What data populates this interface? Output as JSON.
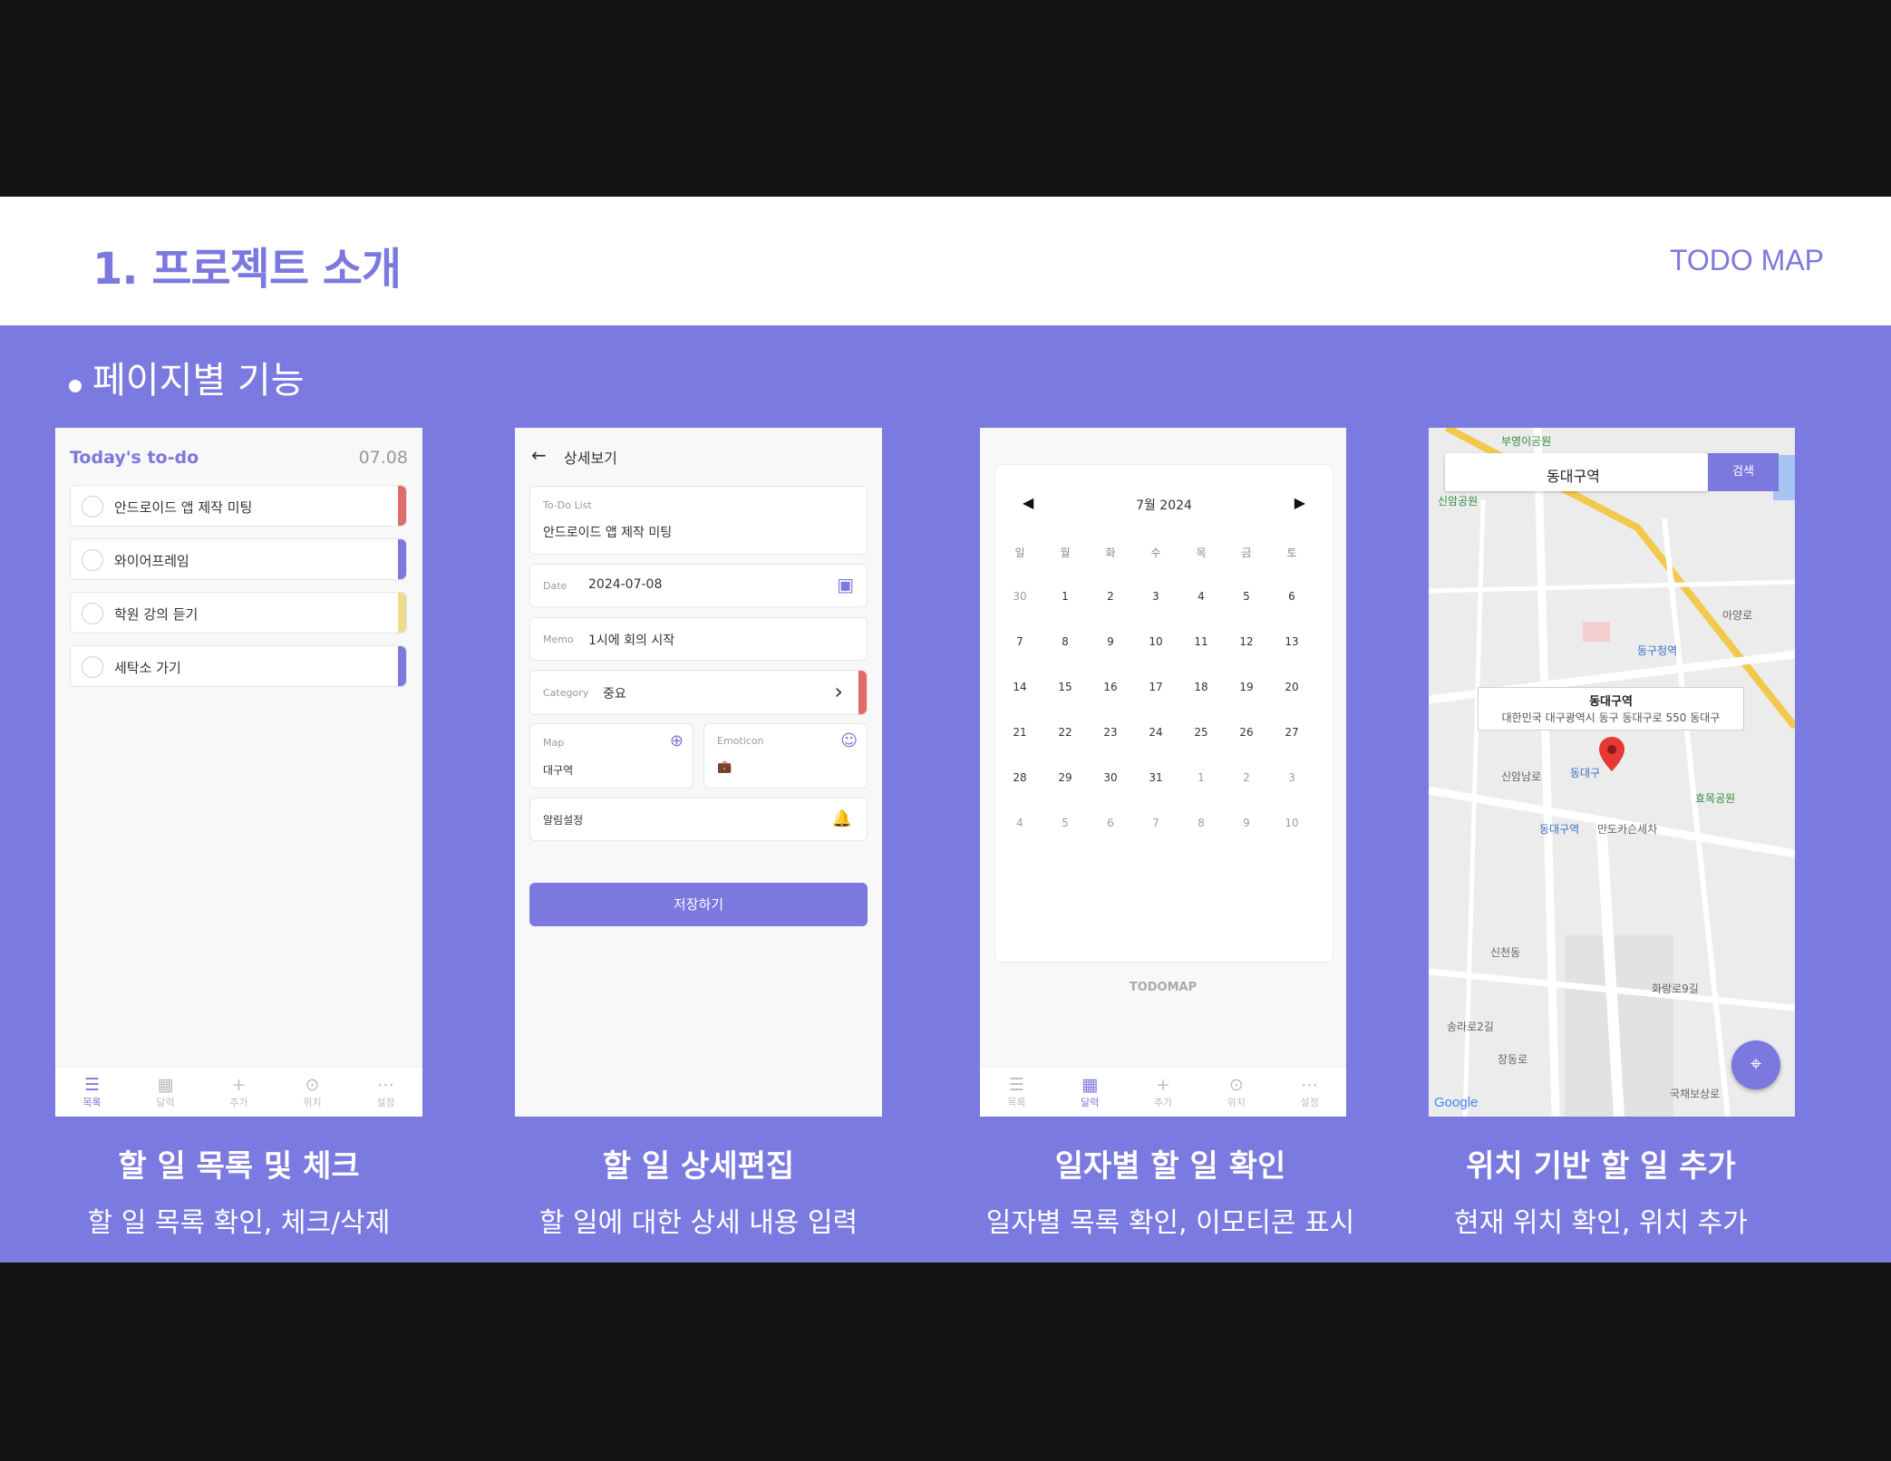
{
  "header": {
    "title": "1. 프로젝트 소개",
    "brand": "TODO MAP"
  },
  "section": {
    "title": "페이지별 기능"
  },
  "panels": [
    {
      "caption": "할 일 목록 및 체크",
      "desc": "할 일 목록 확인, 체크/삭제"
    },
    {
      "caption": "할 일 상세편집",
      "desc": "할 일에 대한 상세 내용 입력"
    },
    {
      "caption": "일자별 할 일 확인",
      "desc": "일자별 목록 확인, 이모티콘 표시"
    },
    {
      "caption": "위치 기반 할 일 추가",
      "desc": "현재 위치 확인, 위치 추가"
    }
  ],
  "todo_screen": {
    "title": "Today's to-do",
    "date": "07.08",
    "items": [
      {
        "label": "안드로이드 앱 제작 미팅",
        "color": "#e06b6b"
      },
      {
        "label": "와이어프레임",
        "color": "#7b78de"
      },
      {
        "label": "학원 강의 듣기",
        "color": "#efdb8e"
      },
      {
        "label": "세탁소 가기",
        "color": "#7b78de"
      }
    ]
  },
  "nav": {
    "items": [
      {
        "label": "목록",
        "icon": "menu-icon",
        "glyph": "☰"
      },
      {
        "label": "달력",
        "icon": "calendar-icon",
        "glyph": "▦"
      },
      {
        "label": "추가",
        "icon": "plus-icon",
        "glyph": "+"
      },
      {
        "label": "위치",
        "icon": "location-icon",
        "glyph": "⊙"
      },
      {
        "label": "설정",
        "icon": "settings-icon",
        "glyph": "⋯"
      }
    ]
  },
  "detail_screen": {
    "header": "상세보기",
    "todo_label": "To-Do List",
    "todo_value": "안드로이드 앱 제작 미팅",
    "date_label": "Date",
    "date_value": "2024-07-08",
    "memo_label": "Memo",
    "memo_value": "1시에 회의 시작",
    "category_label": "Category",
    "category_value": "중요",
    "category_color": "#e06b6b",
    "map_label": "Map",
    "map_value": "대구역",
    "emoticon_label": "Emoticon",
    "emoticon_value": "💼",
    "alarm_label": "알림설정",
    "save_label": "저장하기"
  },
  "calendar_screen": {
    "month": "7월 2024",
    "weekdays": [
      "일",
      "월",
      "화",
      "수",
      "목",
      "금",
      "토"
    ],
    "weeks": [
      [
        "30",
        "1",
        "2",
        "3",
        "4",
        "5",
        "6"
      ],
      [
        "7",
        "8",
        "9",
        "10",
        "11",
        "12",
        "13"
      ],
      [
        "14",
        "15",
        "16",
        "17",
        "18",
        "19",
        "20"
      ],
      [
        "21",
        "22",
        "23",
        "24",
        "25",
        "26",
        "27"
      ],
      [
        "28",
        "29",
        "30",
        "31",
        "1",
        "2",
        "3"
      ],
      [
        "4",
        "5",
        "6",
        "7",
        "8",
        "9",
        "10"
      ]
    ],
    "footer": "TODOMAP"
  },
  "map_screen": {
    "search_value": "동대구역",
    "search_button": "검색",
    "info_title": "동대구역",
    "info_address": "대한민국 대구광역시 동구 동대구로 550 동대구",
    "labels": [
      {
        "text": "부영이공원",
        "kind": "g"
      },
      {
        "text": "신암공원",
        "kind": "g"
      },
      {
        "text": "동구청역",
        "kind": "b"
      },
      {
        "text": "아양로",
        "kind": "n"
      },
      {
        "text": "신암남로",
        "kind": "n"
      },
      {
        "text": "동대구",
        "kind": "b"
      },
      {
        "text": "효목공원",
        "kind": "g"
      },
      {
        "text": "동대구역",
        "kind": "b"
      },
      {
        "text": "만도카슨세차",
        "kind": "n"
      },
      {
        "text": "신천동",
        "kind": "n"
      },
      {
        "text": "화랑로9길",
        "kind": "n"
      },
      {
        "text": "송라로2길",
        "kind": "n"
      },
      {
        "text": "국채보상로",
        "kind": "n"
      },
      {
        "text": "장동로",
        "kind": "n"
      }
    ],
    "google": "Google"
  }
}
